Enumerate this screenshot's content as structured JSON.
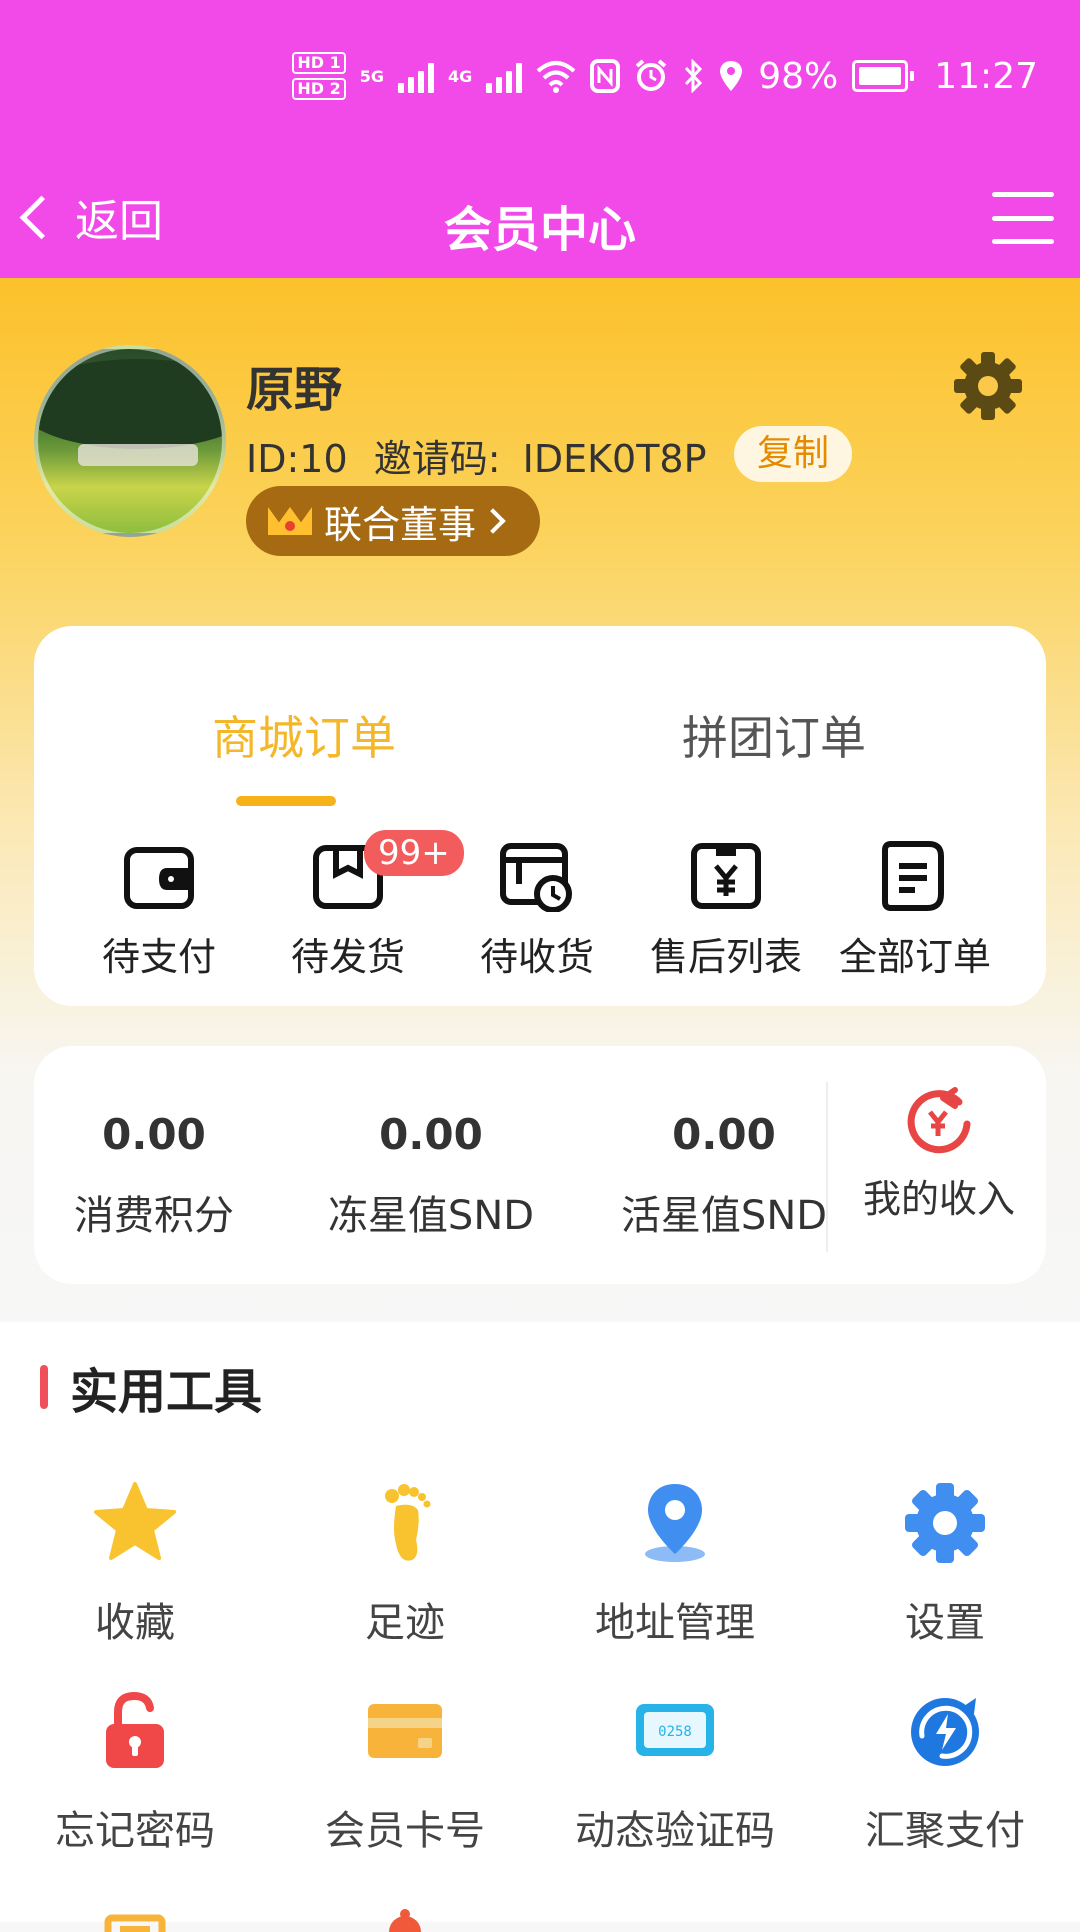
{
  "status_bar": {
    "battery": "98%",
    "time": "11:27",
    "sim1": "HD 1",
    "sim2": "HD 2",
    "net1": "5G",
    "net2": "4G"
  },
  "nav": {
    "back_label": "返回",
    "title": "会员中心"
  },
  "profile": {
    "name": "原野",
    "id_text": "ID:10",
    "invite_label": "邀请码:",
    "invite_code": "IDEK0T8P",
    "copy_label": "复制",
    "level": "联合董事"
  },
  "orders": {
    "tabs": [
      {
        "label": "商城订单"
      },
      {
        "label": "拼团订单"
      }
    ],
    "active_tab": 0,
    "items": [
      {
        "label": "待支付",
        "icon": "wallet-icon"
      },
      {
        "label": "待发货",
        "icon": "box-icon",
        "badge": "99+"
      },
      {
        "label": "待收货",
        "icon": "delivery-clock-icon"
      },
      {
        "label": "售后列表",
        "icon": "yen-receipt-icon"
      },
      {
        "label": "全部订单",
        "icon": "document-list-icon"
      }
    ]
  },
  "assets": {
    "items": [
      {
        "value": "0.00",
        "label": "消费积分"
      },
      {
        "value": "0.00",
        "label": "冻星值SND"
      },
      {
        "value": "0.00",
        "label": "活星值SND"
      }
    ],
    "income": {
      "label": "我的收入",
      "icon": "yen-refresh-icon"
    }
  },
  "tools": {
    "title": "实用工具",
    "items": [
      {
        "label": "收藏",
        "icon": "star-icon",
        "color": "#f8c32f"
      },
      {
        "label": "足迹",
        "icon": "footprint-icon",
        "color": "#f8c32f"
      },
      {
        "label": "地址管理",
        "icon": "location-pin-icon",
        "color": "#3f8ef0"
      },
      {
        "label": "设置",
        "icon": "gear-icon",
        "color": "#3f8ef0"
      },
      {
        "label": "忘记密码",
        "icon": "unlock-icon",
        "color": "#f04848"
      },
      {
        "label": "会员卡号",
        "icon": "card-icon",
        "color": "#f8b43a"
      },
      {
        "label": "动态验证码",
        "icon": "code-icon",
        "color": "#27b3e8",
        "code": "0258"
      },
      {
        "label": "汇聚支付",
        "icon": "refresh-bolt-icon",
        "color": "#1f78e0"
      }
    ]
  },
  "colors": {
    "header": "#f24ae8",
    "accent": "#f5b72a",
    "badge": "#f25c5c",
    "level_bg": "#a56a12"
  }
}
